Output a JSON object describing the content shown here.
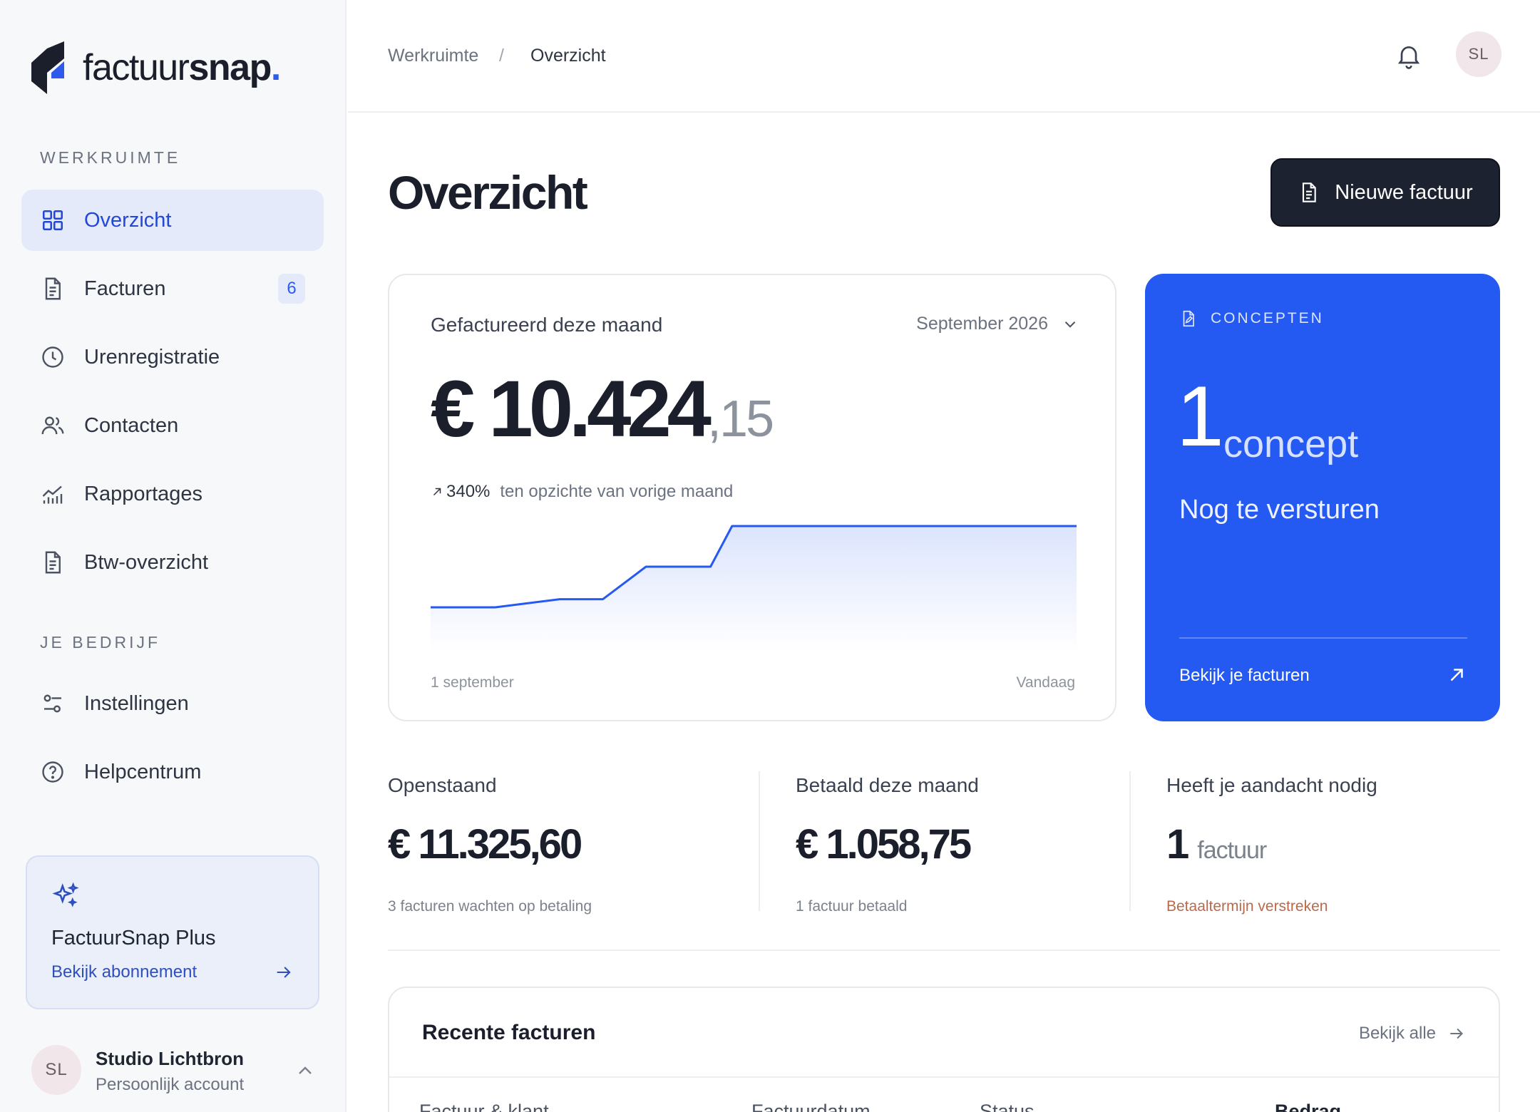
{
  "brand": {
    "name_light": "factuur",
    "name_bold": "snap",
    "dot": ".",
    "accent": "#2459f2"
  },
  "sidebar": {
    "workspace_label": "WERKRUIMTE",
    "items": [
      {
        "label": "Overzicht",
        "icon": "dashboard-icon",
        "active": true
      },
      {
        "label": "Facturen",
        "icon": "document-icon",
        "badge": "6"
      },
      {
        "label": "Urenregistratie",
        "icon": "clock-icon"
      },
      {
        "label": "Contacten",
        "icon": "users-icon"
      },
      {
        "label": "Rapportages",
        "icon": "chart-icon"
      },
      {
        "label": "Btw-overzicht",
        "icon": "document-icon"
      }
    ],
    "company_label": "JE BEDRIJF",
    "company_items": [
      {
        "label": "Instellingen",
        "icon": "sliders-icon"
      },
      {
        "label": "Helpcentrum",
        "icon": "help-icon"
      }
    ],
    "plus": {
      "title": "FactuurSnap Plus",
      "link": "Bekijk abonnement",
      "icon": "sparkle-icon"
    },
    "account": {
      "initials": "SL",
      "name": "Studio Lichtbron",
      "type": "Persoonlijk account"
    }
  },
  "topbar": {
    "breadcrumb": [
      "Werkruimte",
      "Overzicht"
    ],
    "separator": "/",
    "avatar_initials": "SL"
  },
  "page": {
    "title": "Overzicht",
    "new_button": "Nieuwe factuur"
  },
  "invoiced": {
    "title": "Gefactureerd deze maand",
    "month": "September 2026",
    "amount_main": "€ 10.424",
    "amount_cents": ",15",
    "trend_pct": "340%",
    "trend_text": "ten opzichte van vorige maand",
    "x_start": "1 september",
    "x_end": "Vandaag",
    "chart_data": {
      "type": "area",
      "x": [
        0,
        3,
        6,
        8,
        10,
        13,
        14,
        16,
        20,
        25,
        30
      ],
      "y": [
        0,
        0,
        1,
        1,
        5,
        5,
        10,
        10,
        10,
        10,
        10
      ],
      "xlabel": "",
      "ylabel": "",
      "grid": false,
      "color": "#2459f2"
    }
  },
  "concepts": {
    "label": "CONCEPTEN",
    "count": "1",
    "unit": "concept",
    "subtitle": "Nog te versturen",
    "link": "Bekijk je facturen"
  },
  "stats": [
    {
      "label": "Openstaand",
      "value": "€ 11.325,60",
      "unit": "",
      "note": "3 facturen wachten op betaling",
      "warn": false
    },
    {
      "label": "Betaald deze maand",
      "value": "€ 1.058,75",
      "unit": "",
      "note": "1 factuur betaald",
      "warn": false
    },
    {
      "label": "Heeft je aandacht nodig",
      "value": "1",
      "unit": "factuur",
      "note": "Betaaltermijn verstreken",
      "warn": true
    }
  ],
  "recent": {
    "title": "Recente facturen",
    "link": "Bekijk alle",
    "columns": [
      "Factuur & klant",
      "Factuurdatum",
      "Status",
      "Bedrag"
    ]
  }
}
